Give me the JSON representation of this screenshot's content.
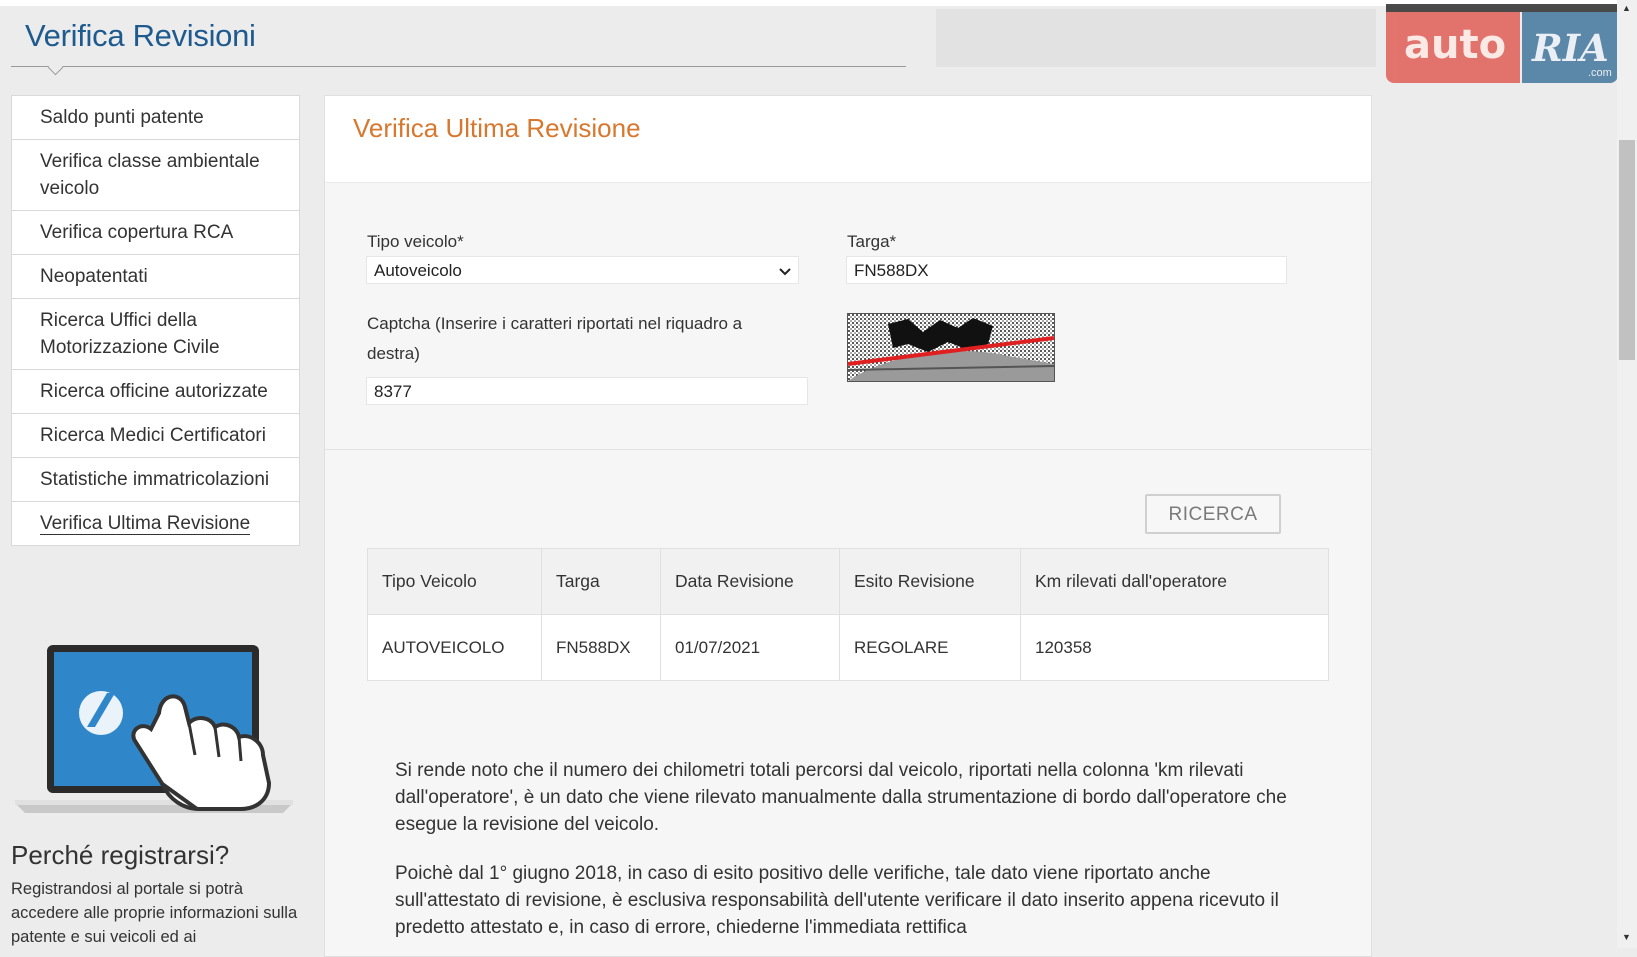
{
  "header": {
    "site_title": "Verifica Revisioni"
  },
  "watermark": {
    "left_text": "auto",
    "right_text": "RIA",
    "suffix": ".com"
  },
  "sidebar": {
    "items": [
      {
        "label": "Saldo punti patente"
      },
      {
        "label": "Verifica classe ambientale veicolo"
      },
      {
        "label": "Verifica copertura RCA"
      },
      {
        "label": "Neopatentati"
      },
      {
        "label": "Ricerca Uffici della Motorizzazione Civile"
      },
      {
        "label": "Ricerca officine autorizzate"
      },
      {
        "label": "Ricerca Medici Certificatori"
      },
      {
        "label": "Statistiche immatricolazioni"
      },
      {
        "label": "Verifica Ultima Revisione",
        "active": true
      }
    ],
    "why_title": "Perché registrarsi?",
    "why_text": "Registrandosi al portale si potrà accedere alle proprie informazioni sulla patente e sui  veicoli ed ai"
  },
  "form": {
    "title": "Verifica Ultima Revisione",
    "tipo_veicolo_label": "Tipo veicolo*",
    "tipo_veicolo_value": "Autoveicolo",
    "targa_label": "Targa*",
    "targa_value": "FN588DX",
    "captcha_label": "Captcha (Inserire i caratteri riportati nel riquadro a destra)",
    "captcha_value": "8377",
    "search_label": "RICERCA"
  },
  "results": {
    "columns": [
      "Tipo Veicolo",
      "Targa",
      "Data Revisione",
      "Esito Revisione",
      "Km rilevati dall'operatore"
    ],
    "rows": [
      [
        "AUTOVEICOLO",
        "FN588DX",
        "01/07/2021",
        "REGOLARE",
        "120358"
      ]
    ]
  },
  "notes": {
    "p1": "Si rende noto che il numero dei chilometri totali percorsi dal veicolo, riportati nella colonna 'km rilevati dall'operatore', è un dato che viene rilevato manualmente dalla strumentazione di bordo dall'operatore che esegue la revisione del veicolo.",
    "p2": "Poichè dal 1° giugno 2018, in caso di esito positivo delle verifiche, tale dato viene riportato anche sull'attestato di revisione, è esclusiva responsabilità dell'utente verificare il dato inserito appena ricevuto il predetto attestato e, in caso di errore, chiederne l'immediata rettifica"
  },
  "colors": {
    "title_blue": "#1f5a8f",
    "title_orange": "#d8782f",
    "background": "#ececec"
  }
}
